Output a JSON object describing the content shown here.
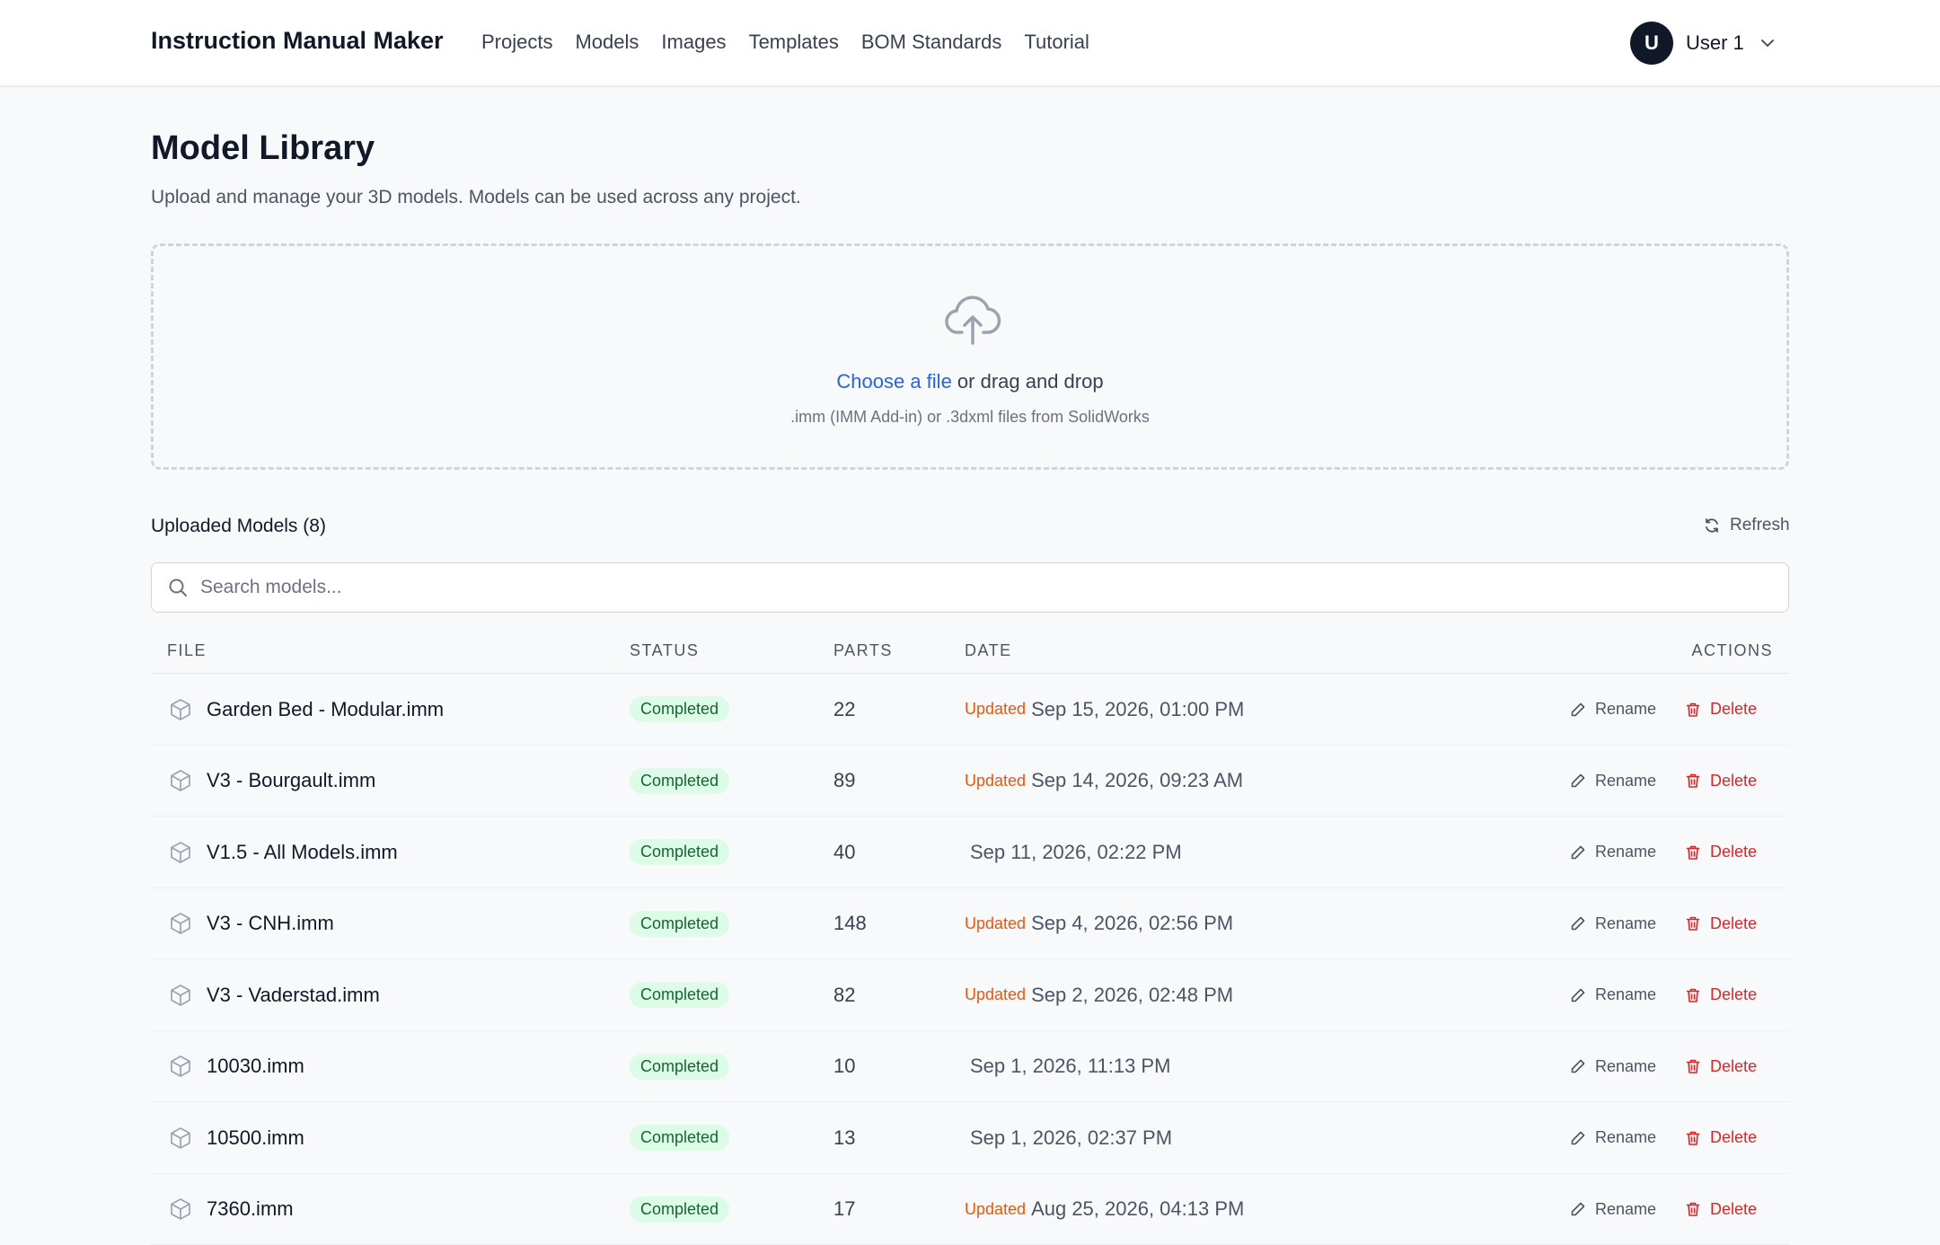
{
  "nav": {
    "brand": "Instruction Manual Maker",
    "links": [
      "Projects",
      "Models",
      "Images",
      "Templates",
      "BOM Standards",
      "Tutorial"
    ],
    "user_initial": "U",
    "user_name": "User 1"
  },
  "page": {
    "title": "Model Library",
    "subtitle": "Upload and manage your 3D models. Models can be used across any project."
  },
  "upload": {
    "choose_label": "Choose a file",
    "drag_label": " or drag and drop",
    "hint": ".imm (IMM Add-in) or .3dxml files from SolidWorks"
  },
  "list": {
    "title": "Uploaded Models (8)",
    "refresh_label": "Refresh",
    "search_placeholder": "Search models..."
  },
  "table": {
    "headers": {
      "file": "FILE",
      "status": "STATUS",
      "parts": "PARTS",
      "date": "DATE",
      "actions": "ACTIONS"
    },
    "rename_label": "Rename",
    "delete_label": "Delete",
    "rows": [
      {
        "file": "Garden Bed - Modular.imm",
        "status": "Completed",
        "parts": "22",
        "updated": "Updated",
        "date": "Sep 15, 2026, 01:00 PM"
      },
      {
        "file": "V3 - Bourgault.imm",
        "status": "Completed",
        "parts": "89",
        "updated": "Updated",
        "date": "Sep 14, 2026, 09:23 AM"
      },
      {
        "file": "V1.5 - All Models.imm",
        "status": "Completed",
        "parts": "40",
        "updated": "",
        "date": "Sep 11, 2026, 02:22 PM"
      },
      {
        "file": "V3 - CNH.imm",
        "status": "Completed",
        "parts": "148",
        "updated": "Updated",
        "date": "Sep 4, 2026, 02:56 PM"
      },
      {
        "file": "V3 - Vaderstad.imm",
        "status": "Completed",
        "parts": "82",
        "updated": "Updated",
        "date": "Sep 2, 2026, 02:48 PM"
      },
      {
        "file": "10030.imm",
        "status": "Completed",
        "parts": "10",
        "updated": "",
        "date": "Sep 1, 2026, 11:13 PM"
      },
      {
        "file": "10500.imm",
        "status": "Completed",
        "parts": "13",
        "updated": "",
        "date": "Sep 1, 2026, 02:37 PM"
      },
      {
        "file": "7360.imm",
        "status": "Completed",
        "parts": "17",
        "updated": "Updated",
        "date": "Aug 25, 2026, 04:13 PM"
      }
    ]
  },
  "colors": {
    "accent": "#2563eb",
    "updated": "#ea580c",
    "delete": "#dc2626",
    "badge_bg": "#dcfce7",
    "badge_text": "#166534"
  },
  "icons": {
    "upload": "cloud-upload-icon",
    "refresh": "refresh-icon",
    "search": "search-icon",
    "file": "cube-icon",
    "rename": "pencil-icon",
    "delete": "trash-icon",
    "user_menu": "chevron-down-icon"
  }
}
